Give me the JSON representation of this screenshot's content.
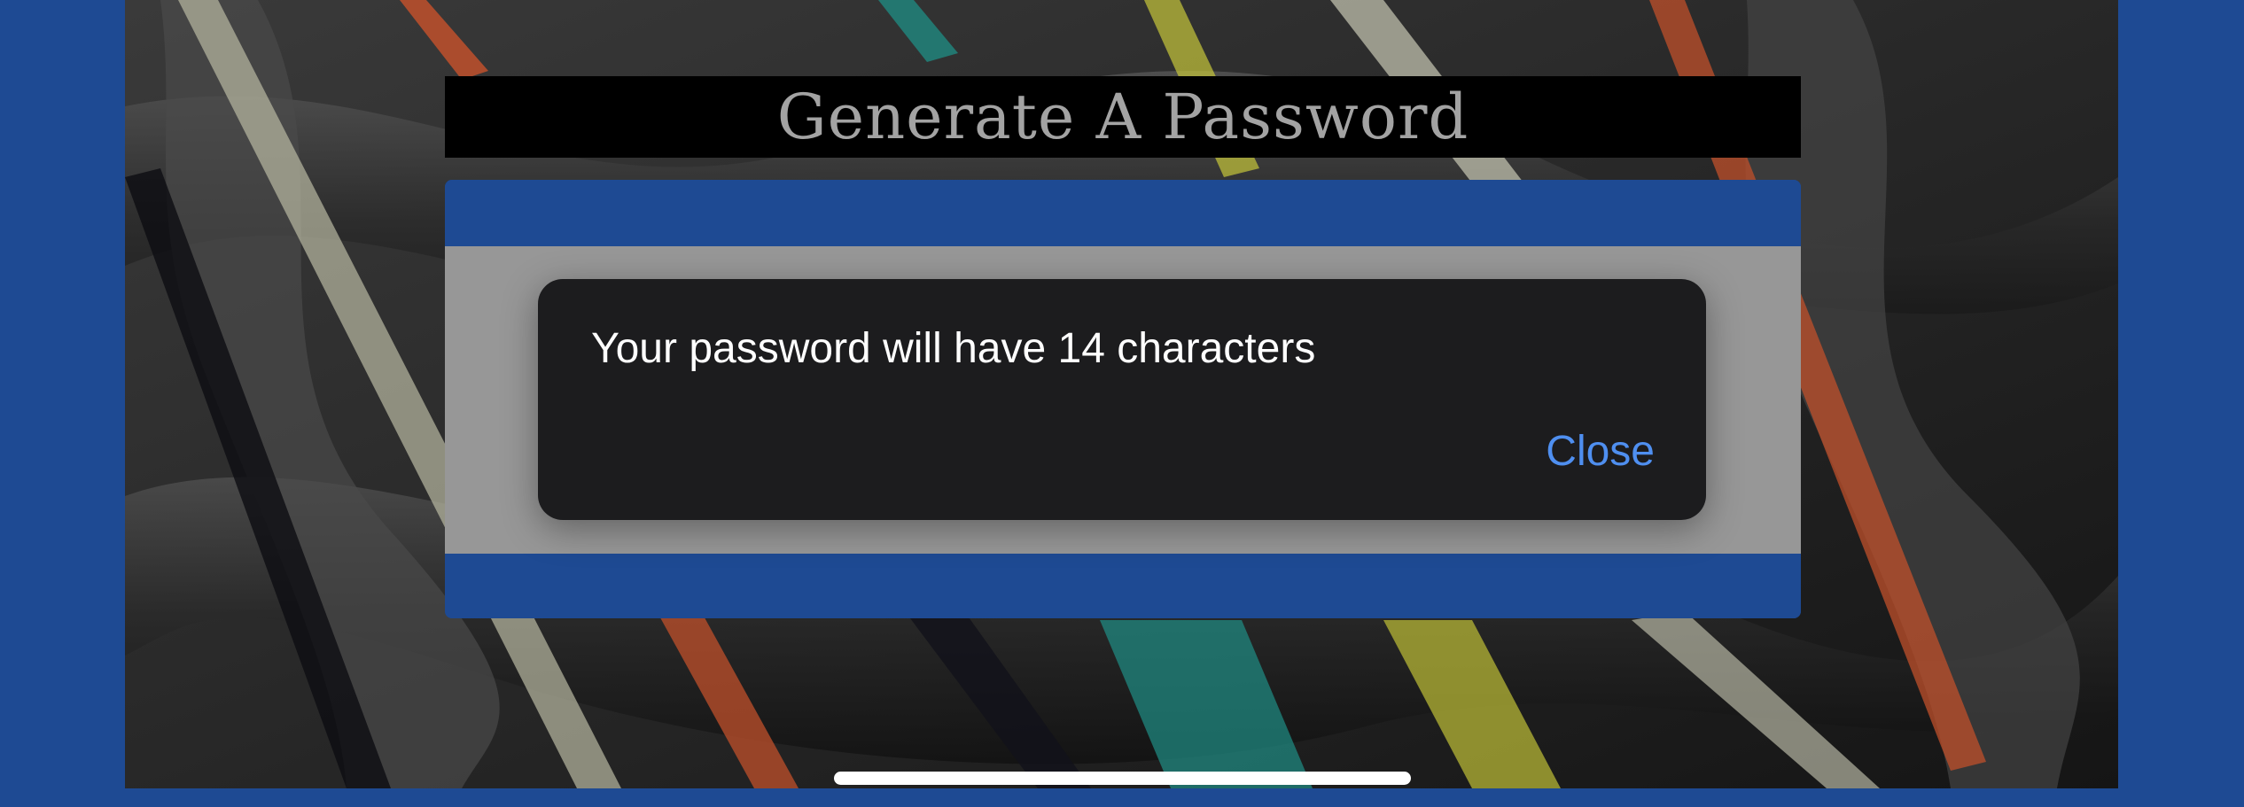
{
  "header": {
    "title": "Generate A Password"
  },
  "alert": {
    "message": "Your password will have 14 characters",
    "close_label": "Close"
  },
  "colors": {
    "frame": "#1e4a93",
    "title_bar": "#000000",
    "title_text": "#a3a3a3",
    "card_band": "#1e4a93",
    "card_body": "#979797",
    "alert_bg": "#1c1c1e",
    "alert_text": "#ffffff",
    "alert_action": "#4f8ff0"
  },
  "background": {
    "description_icon": "abstract-woven-ribbons-wallpaper"
  }
}
